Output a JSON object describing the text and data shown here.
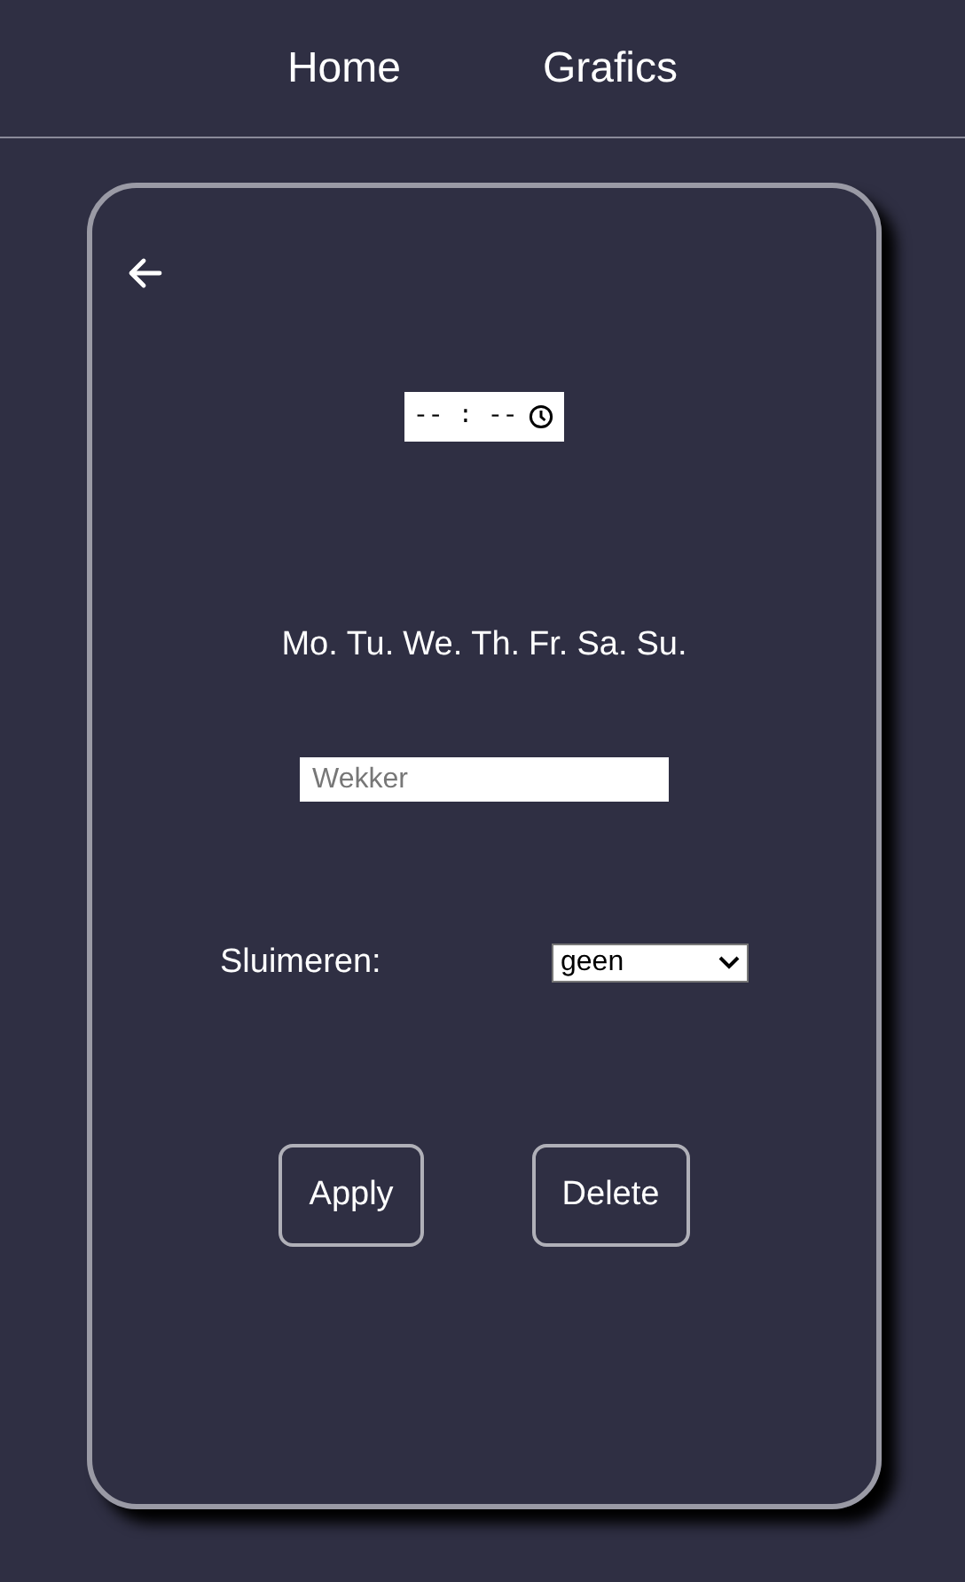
{
  "nav": {
    "links": [
      "Home",
      "Grafics"
    ]
  },
  "time_field": {
    "value": "-- : --"
  },
  "days": [
    "Mo.",
    "Tu.",
    "We.",
    "Th.",
    "Fr.",
    "Sa.",
    "Su."
  ],
  "name_field": {
    "placeholder": "Wekker"
  },
  "snooze": {
    "label": "Sluimeren:",
    "value": "geen"
  },
  "buttons": [
    "Apply",
    "Delete"
  ]
}
